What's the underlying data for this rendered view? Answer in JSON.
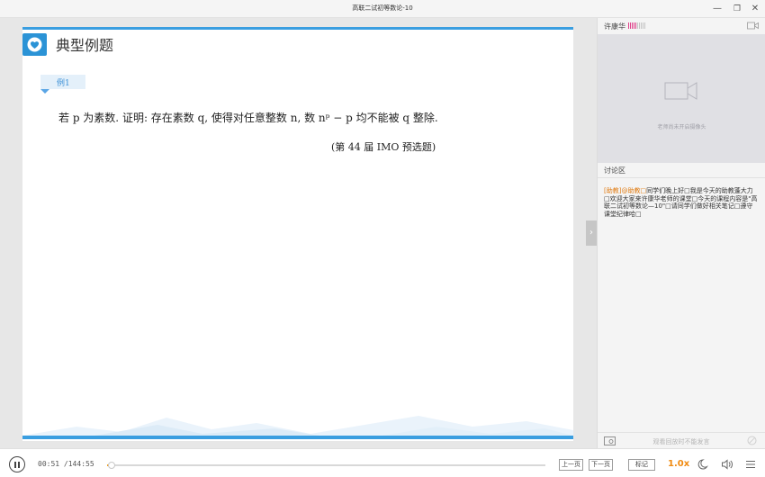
{
  "window": {
    "title": "高联二试初等数论-10",
    "controls": {
      "minimize": "—",
      "maximize": "❐",
      "close": "✕"
    }
  },
  "slide": {
    "title": "典型例题",
    "example_label": "例1",
    "problem": "若 p 为素数. 证明: 存在素数 q, 使得对任意整数 n, 数 nᵖ − p 均不能被 q 整除.",
    "reference": "(第 44 届 IMO 预选题)"
  },
  "side_panel": {
    "teacher_name": "许康华",
    "signal_colors": {
      "active": "#e0408a",
      "inactive": "#c4c4c4"
    },
    "camera_off_text": "老师尚未开启摄像头",
    "discussion_title": "讨论区",
    "chat": [
      {
        "sender": "[助教]@助教□",
        "text": "同学们晚上好□我是今天的助教蓬大力□欢迎大家来许康华老师的课堂□今天的课程内容是\"高联二试初等数论—10\"□请同学们做好相关笔记□遵守课堂纪律哈□"
      }
    ],
    "chat_disabled_text": "观看回放时不能发言"
  },
  "player": {
    "current_time": "00:51",
    "total_time": "/144:55",
    "progress": 0.0059,
    "prev_label": "上一页",
    "next_label": "下一页",
    "mark_label": "标记",
    "speed": "1.0x",
    "colors": {
      "accent": "#f08a10",
      "slide_blue": "#3a9ee0"
    }
  }
}
